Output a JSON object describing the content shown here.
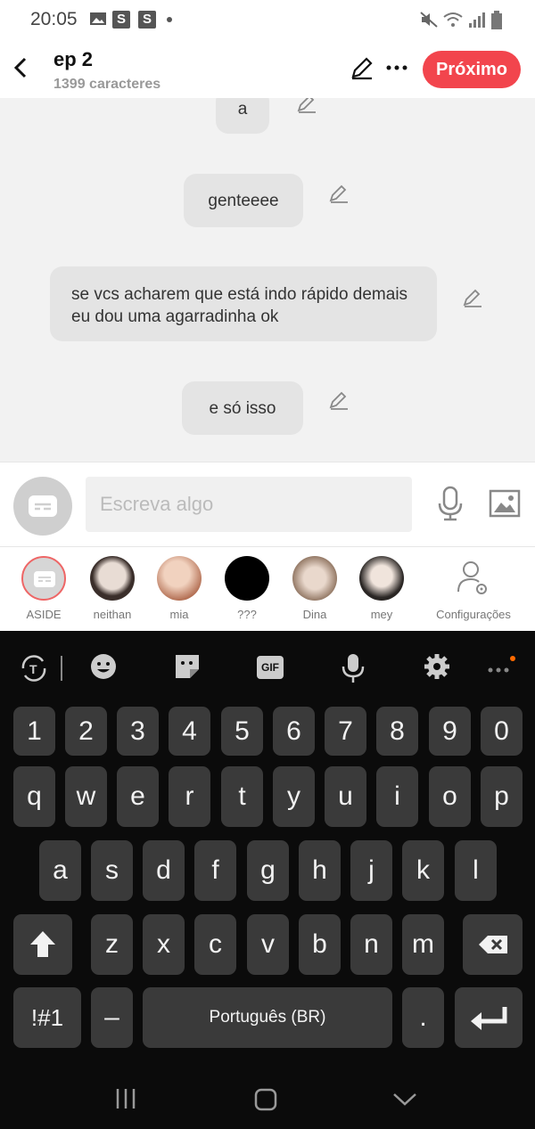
{
  "status_bar": {
    "time": "20:05",
    "s_badge": "S"
  },
  "header": {
    "title": "ep 2",
    "char_count": "1399 caracteres",
    "next_label": "Próximo"
  },
  "messages": [
    {
      "text": "a"
    },
    {
      "text": "genteeee"
    },
    {
      "text": "se vcs acharem que está indo rápido demais eu dou uma agarradinha ok"
    },
    {
      "text": "e só isso"
    }
  ],
  "composer": {
    "placeholder": "Escreva algo"
  },
  "characters": [
    {
      "name": "ASIDE"
    },
    {
      "name": "neithan"
    },
    {
      "name": "mia"
    },
    {
      "name": "???"
    },
    {
      "name": "Dina"
    },
    {
      "name": "mey"
    },
    {
      "name": "Configurações"
    }
  ],
  "keyboard": {
    "toolbar": {
      "gif": "GIF"
    },
    "number_row": [
      "1",
      "2",
      "3",
      "4",
      "5",
      "6",
      "7",
      "8",
      "9",
      "0"
    ],
    "row1": [
      "q",
      "w",
      "e",
      "r",
      "t",
      "y",
      "u",
      "i",
      "o",
      "p"
    ],
    "row2": [
      "a",
      "s",
      "d",
      "f",
      "g",
      "h",
      "j",
      "k",
      "l"
    ],
    "row3": [
      "z",
      "x",
      "c",
      "v",
      "b",
      "n",
      "m"
    ],
    "symbols": "!#1",
    "dash": "–",
    "space": "Português (BR)",
    "period": "."
  },
  "colors": {
    "accent": "#f2454d",
    "bubble": "#e4e4e4",
    "keyboard_bg": "#0b0b0b",
    "key": "#3a3a3a"
  }
}
